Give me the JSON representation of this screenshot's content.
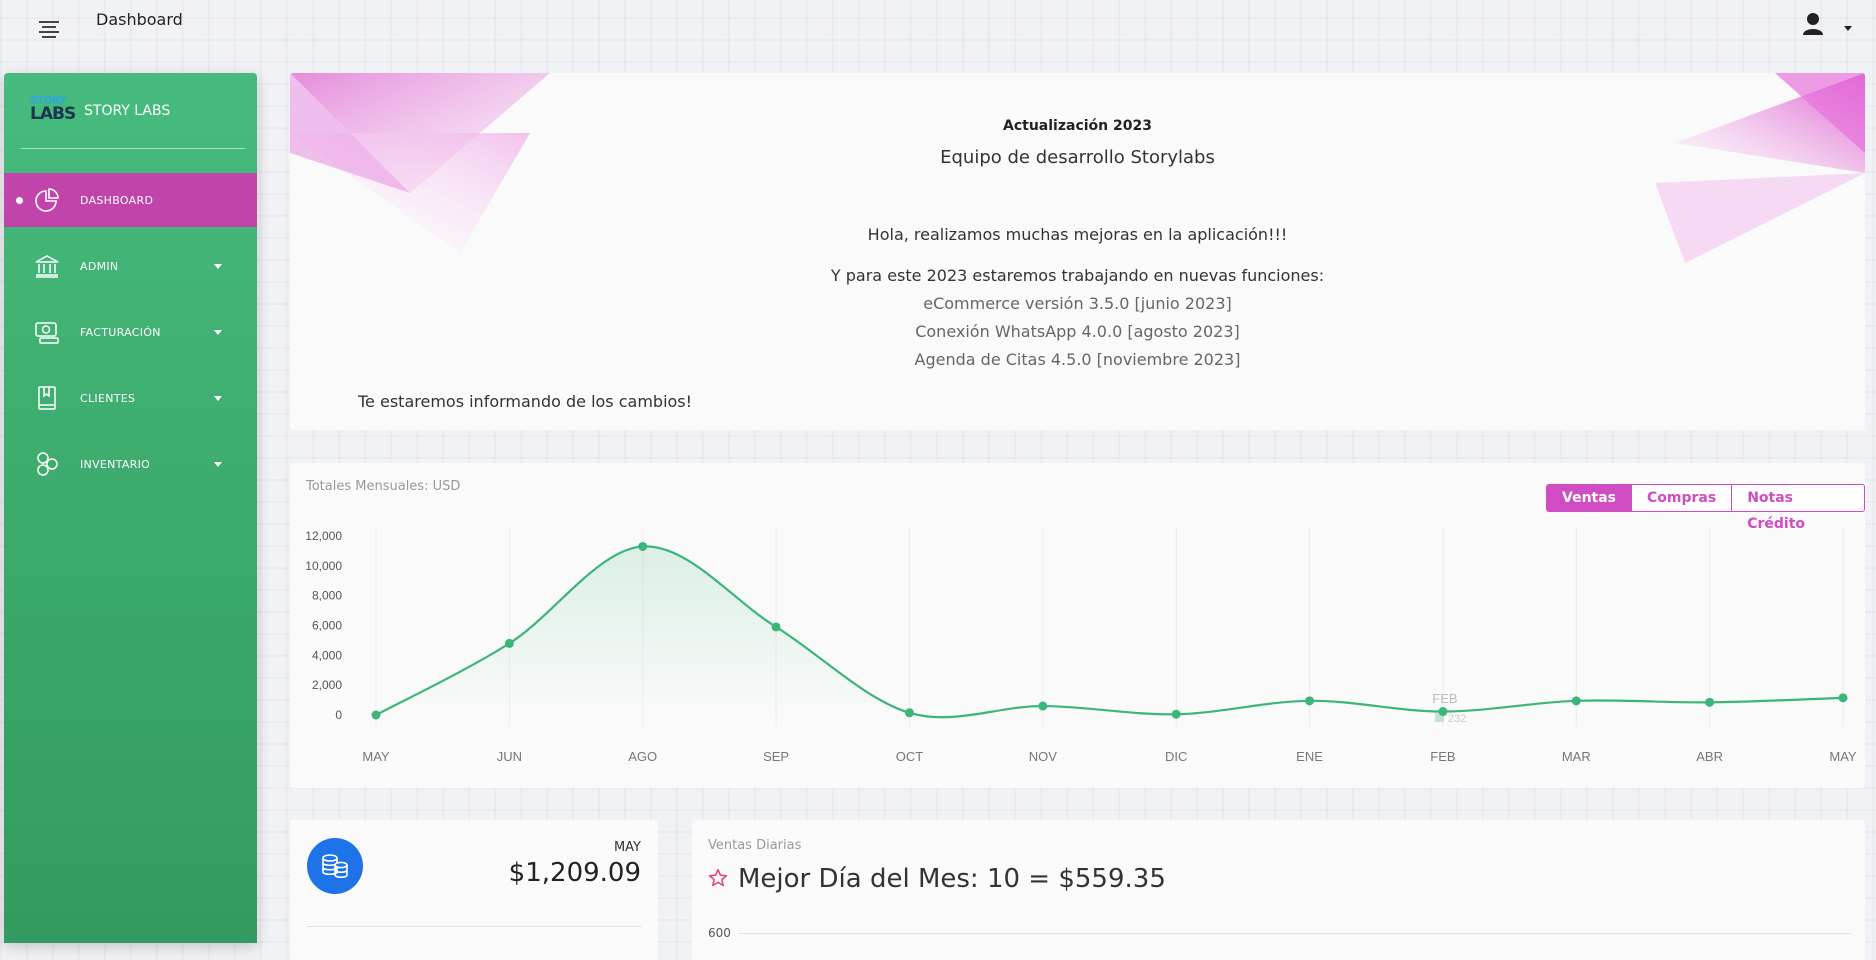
{
  "header": {
    "title": "Dashboard"
  },
  "brand": {
    "logo_top": "STORY",
    "logo_bottom": "LABS",
    "name": "STORY LABS"
  },
  "sidebar": {
    "items": [
      {
        "label": "DASHBOARD",
        "icon": "pie-chart-icon",
        "active": true
      },
      {
        "label": "ADMIN",
        "icon": "bank-icon",
        "has_submenu": true
      },
      {
        "label": "FACTURACIÓN",
        "icon": "money-icon",
        "has_submenu": true
      },
      {
        "label": "CLIENTES",
        "icon": "book-icon",
        "has_submenu": true
      },
      {
        "label": "INVENTARIO",
        "icon": "circles-icon",
        "has_submenu": true
      }
    ]
  },
  "announcement": {
    "title": "Actualización 2023",
    "subtitle": "Equipo de desarrollo Storylabs",
    "paragraph1": "Hola, realizamos muchas mejoras en la aplicación!!!",
    "paragraph2": "Y para este 2023 estaremos trabajando en nuevas funciones:",
    "features": [
      "eCommerce versión 3.5.0 [junio 2023]",
      "Conexión WhatsApp 4.0.0 [agosto 2023]",
      "Agenda de Citas 4.5.0 [noviembre 2023]"
    ],
    "closing": "Te estaremos informando de los cambios!"
  },
  "chart_tabs": {
    "ventas": "Ventas",
    "compras": "Compras",
    "notas": "Notas Crédito"
  },
  "chart_data": {
    "type": "area",
    "title": "Totales Mensuales: USD",
    "categories": [
      "MAY",
      "JUN",
      "AGO",
      "SEP",
      "OCT",
      "NOV",
      "DIC",
      "ENE",
      "FEB",
      "MAR",
      "ABR",
      "MAY"
    ],
    "series": [
      {
        "values": [
          0,
          4800,
          11300,
          5900,
          150,
          600,
          50,
          950,
          232,
          950,
          850,
          1150
        ]
      }
    ],
    "y_ticks": [
      "0",
      "2,000",
      "4,000",
      "6,000",
      "8,000",
      "10,000",
      "12,000"
    ],
    "ylim": [
      0,
      12000
    ],
    "color": "#3bb57a",
    "grid": "vertical",
    "tooltip": {
      "label": "FEB",
      "value": "232"
    }
  },
  "stat_card": {
    "period": "MAY",
    "value": "$1,209.09",
    "icon": "coins-icon"
  },
  "daily_card": {
    "caption": "Ventas Diarias",
    "title": "Mejor Día del Mes: 10 = $559.35",
    "y_tick": "600",
    "icon": "star-icon"
  }
}
